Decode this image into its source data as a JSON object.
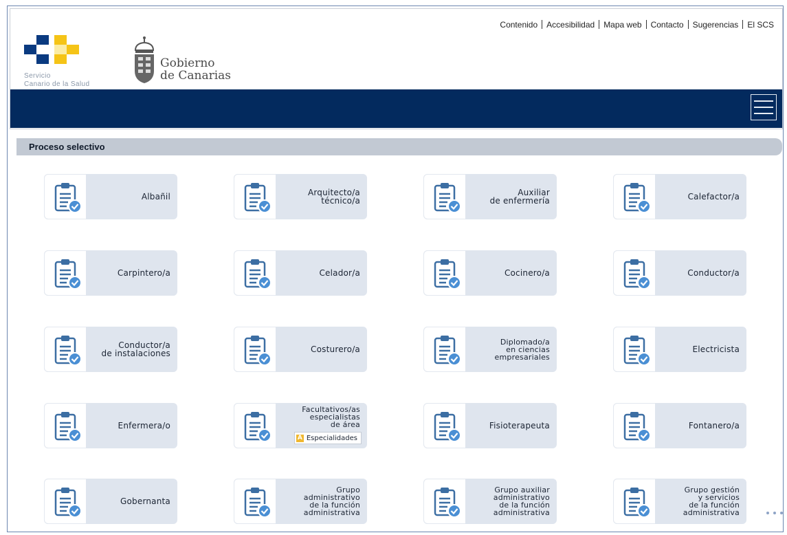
{
  "header": {
    "top_links": [
      "Contenido",
      "Accesibilidad",
      "Mapa web",
      "Contacto",
      "Sugerencias",
      "El SCS"
    ],
    "scs_logo_text_line1": "Servicio",
    "scs_logo_text_line2": "Canario de la Salud",
    "gob_logo_line1": "Gobierno",
    "gob_logo_line2": "de Canarias",
    "menu_icon": "hamburger-icon",
    "nav_color": "#032a5e"
  },
  "section": {
    "title": "Proceso selectivo"
  },
  "tiles": [
    {
      "label": "Albañil"
    },
    {
      "label": "Arquitecto/a\ntécnico/a"
    },
    {
      "label": "Auxiliar\nde enfermería"
    },
    {
      "label": "Calefactor/a"
    },
    {
      "label": "Carpintero/a"
    },
    {
      "label": "Celador/a"
    },
    {
      "label": "Cocinero/a"
    },
    {
      "label": "Conductor/a"
    },
    {
      "label": "Conductor/a\nde instalaciones"
    },
    {
      "label": "Costurero/a"
    },
    {
      "label": "Diplomado/a\nen ciencias\nempresariales"
    },
    {
      "label": "Electricista"
    },
    {
      "label": "Enfermera/o"
    },
    {
      "label": "Facultativos/as\nespecialistas\nde área",
      "badge": "Especialidades",
      "badge_letter": "A"
    },
    {
      "label": "Fisioterapeuta"
    },
    {
      "label": "Fontanero/a"
    },
    {
      "label": "Gobernanta"
    },
    {
      "label": "Grupo\nadministrativo\nde la función\nadministrativa"
    },
    {
      "label": "Grupo auxiliar\nadministrativo\nde la función\nadministrativa"
    },
    {
      "label": "Grupo gestión\ny servicios\nde la función\nadministrativa"
    }
  ],
  "tile_icon": "clipboard-check-icon"
}
